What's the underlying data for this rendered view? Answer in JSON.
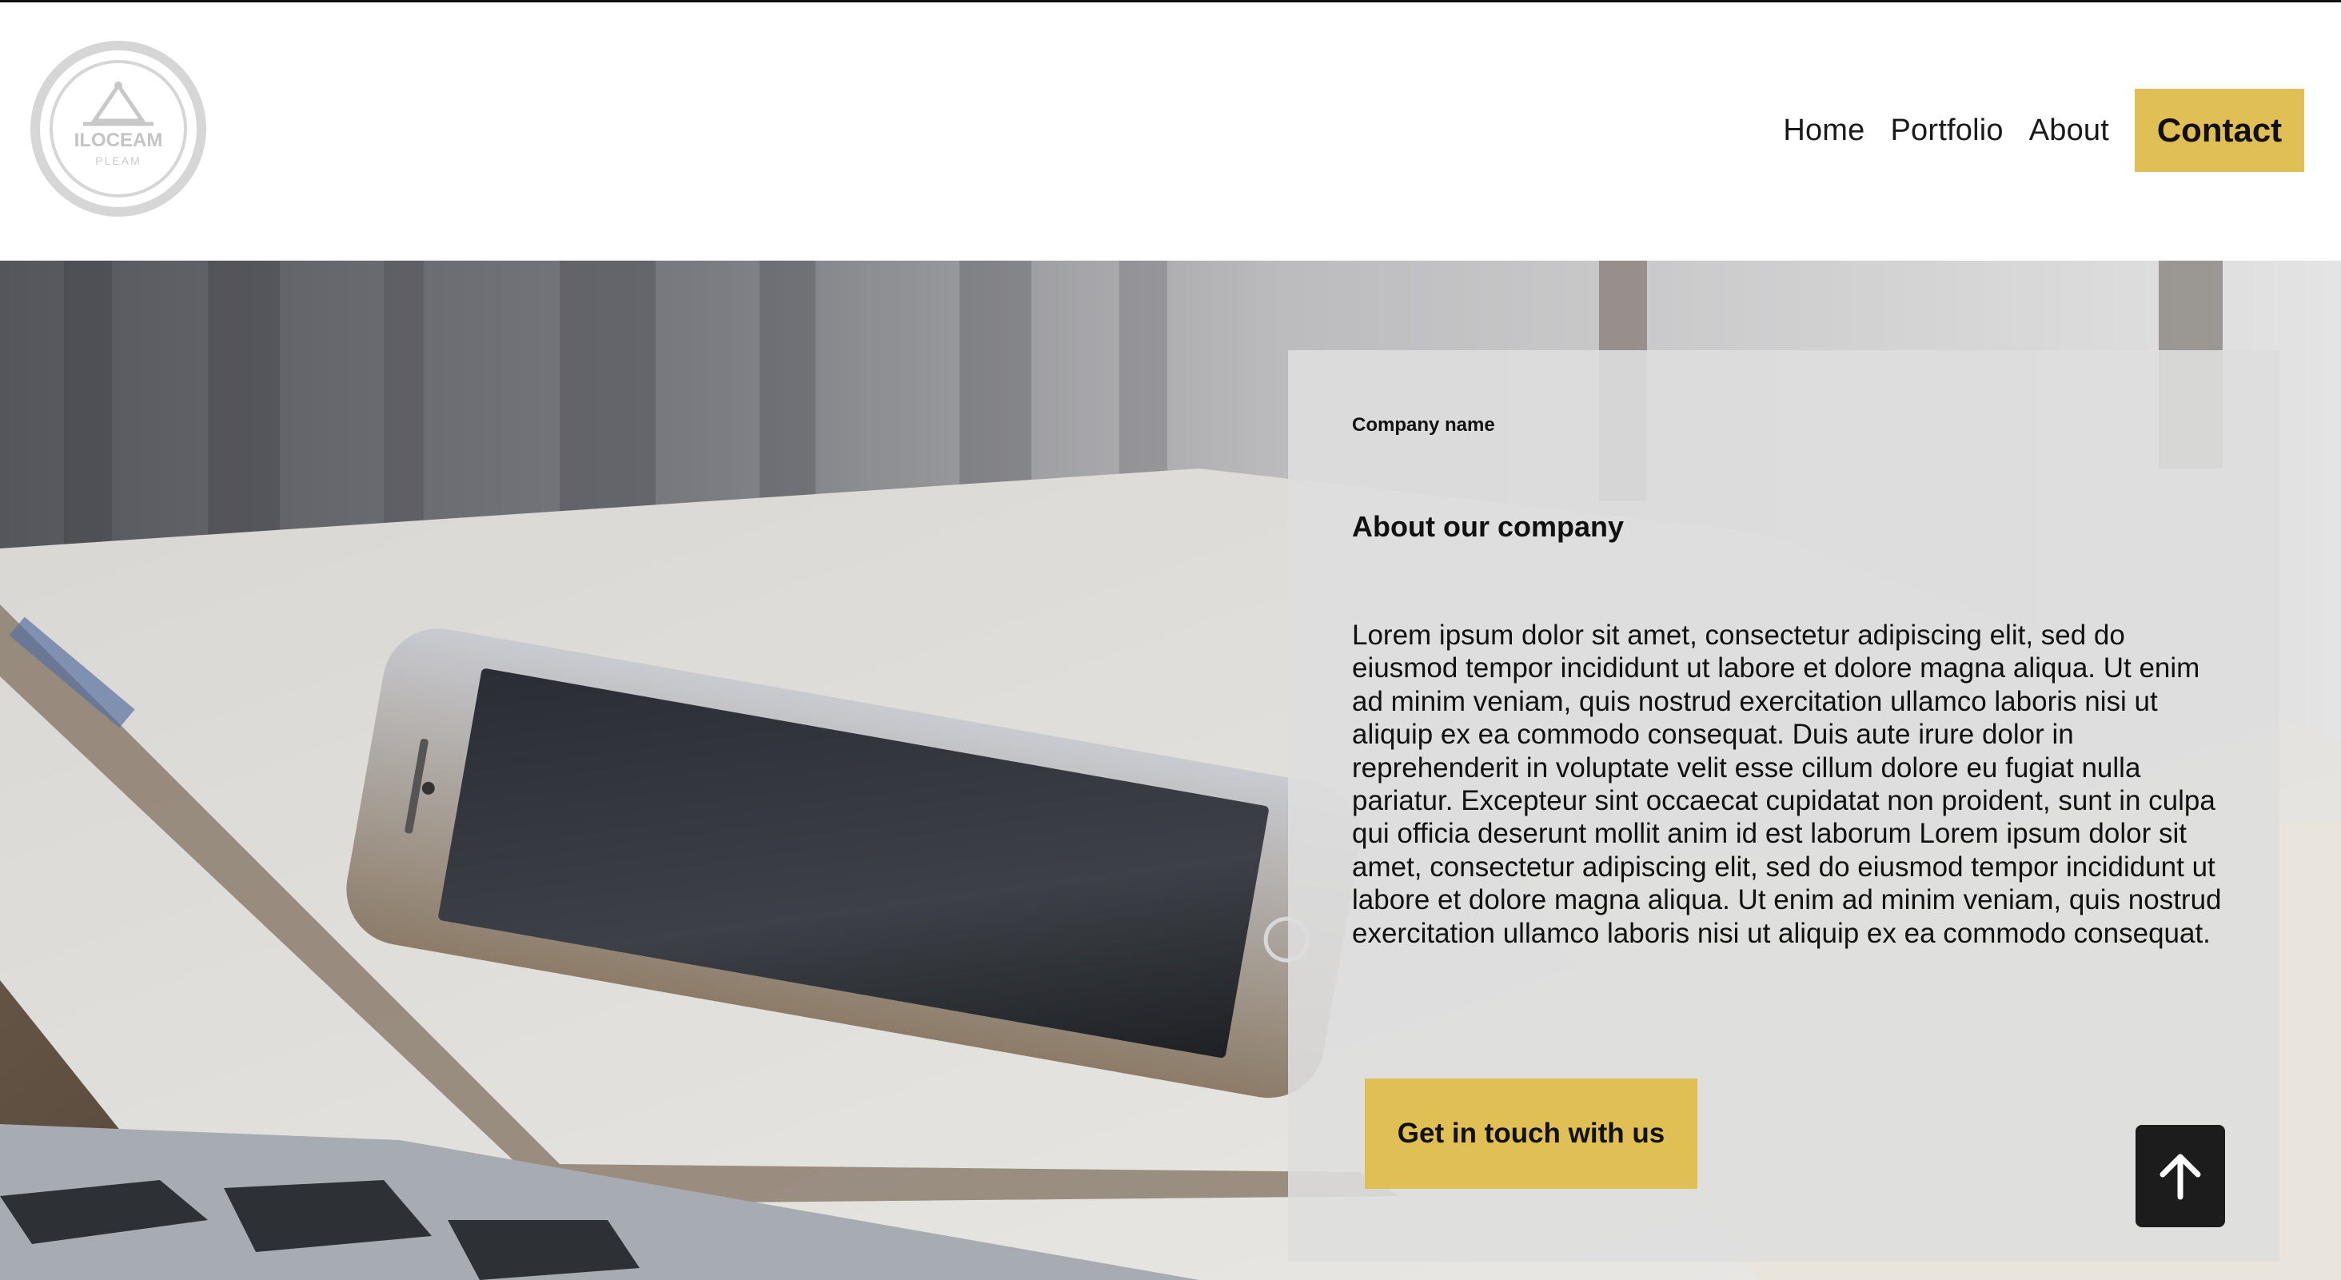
{
  "nav": {
    "items": [
      {
        "label": "Home"
      },
      {
        "label": "Portfolio"
      },
      {
        "label": "About"
      }
    ],
    "contact_label": "Contact"
  },
  "logo": {
    "text_main": "ILOCEAM",
    "text_sub": "PLEAM"
  },
  "about": {
    "company_name": "Company name",
    "title": "About our company",
    "body": "Lorem ipsum dolor sit amet, consectetur adipiscing elit, sed do eiusmod tempor incididunt ut labore et dolore magna aliqua. Ut enim ad minim veniam, quis nostrud exercitation ullamco laboris nisi ut aliquip ex ea commodo consequat. Duis aute irure dolor in reprehenderit in voluptate velit esse cillum dolore eu fugiat nulla pariatur. Excepteur sint occaecat cupidatat non proident, sunt in culpa qui officia deserunt mollit anim id est laborum Lorem ipsum dolor sit amet, consectetur adipiscing elit, sed do eiusmod tempor incididunt ut labore et dolore magna aliqua. Ut enim ad minim veniam, quis nostrud exercitation ullamco laboris nisi ut aliquip ex ea commodo consequat.",
    "cta_label": "Get in touch with us"
  },
  "colors": {
    "accent": "#e0bf55",
    "panel": "#dedede",
    "dark": "#1c1c1c"
  },
  "icons": {
    "scroll_top": "arrow-up-icon"
  }
}
